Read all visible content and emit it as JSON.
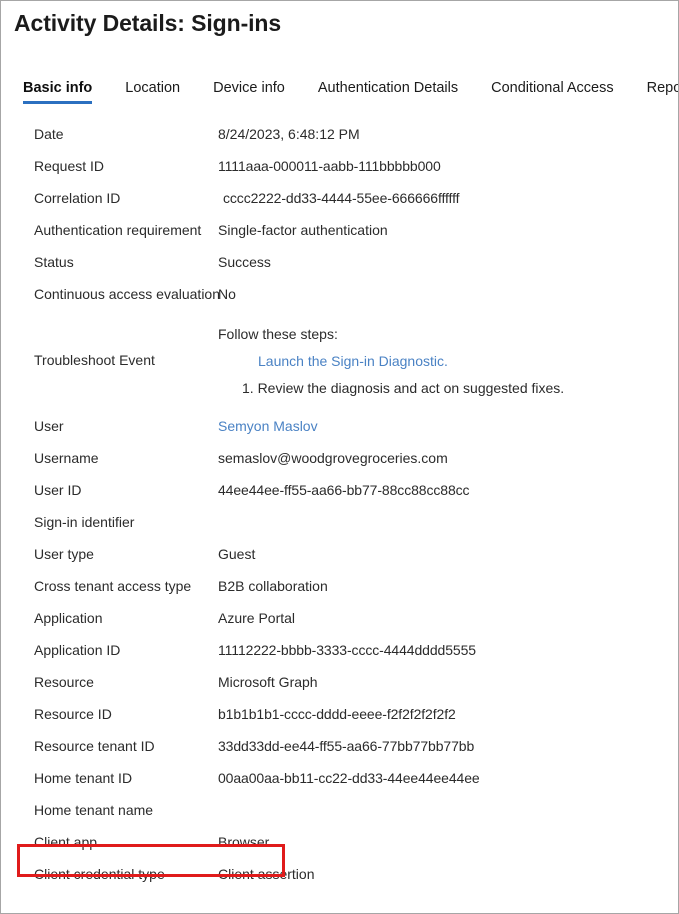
{
  "header": {
    "title": "Activity Details: Sign-ins"
  },
  "tabs": [
    {
      "label": "Basic info",
      "selected": true
    },
    {
      "label": "Location",
      "selected": false
    },
    {
      "label": "Device info",
      "selected": false
    },
    {
      "label": "Authentication Details",
      "selected": false
    },
    {
      "label": "Conditional Access",
      "selected": false
    },
    {
      "label": "Report-only",
      "selected": false
    }
  ],
  "rows": {
    "date": {
      "label": "Date",
      "value": "8/24/2023, 6:48:12 PM"
    },
    "request_id": {
      "label": "Request ID",
      "value": "1111aaa-000011-aabb-111bbbbb000"
    },
    "correlation_id": {
      "label": "Correlation ID",
      "value": "cccc2222-dd33-4444-55ee-666666ffffff"
    },
    "auth_requirement": {
      "label": "Authentication requirement",
      "value": "Single-factor authentication"
    },
    "status": {
      "label": "Status",
      "value": "Success"
    },
    "cae": {
      "label": "Continuous access evaluation",
      "value": "No"
    },
    "troubleshoot": {
      "label": "Troubleshoot Event",
      "intro": "Follow these steps:",
      "link": "Launch the Sign-in Diagnostic.",
      "step1": "1. Review the diagnosis and act on suggested fixes."
    },
    "user": {
      "label": "User",
      "value": "Semyon Maslov"
    },
    "username": {
      "label": "Username",
      "value": "semaslov@woodgrovegroceries.com"
    },
    "user_id": {
      "label": "User ID",
      "value": "44ee44ee-ff55-aa66-bb77-88cc88cc88cc"
    },
    "signin_identifier": {
      "label": "Sign-in identifier",
      "value": ""
    },
    "user_type": {
      "label": "User type",
      "value": "Guest"
    },
    "cross_tenant": {
      "label": "Cross tenant access type",
      "value": "B2B collaboration"
    },
    "application": {
      "label": "Application",
      "value": "Azure Portal"
    },
    "application_id": {
      "label": "Application ID",
      "value": "11112222-bbbb-3333-cccc-4444dddd5555"
    },
    "resource": {
      "label": "Resource",
      "value": "Microsoft Graph"
    },
    "resource_id": {
      "label": "Resource ID",
      "value": "b1b1b1b1-cccc-dddd-eeee-f2f2f2f2f2f2"
    },
    "resource_tenant_id": {
      "label": "Resource tenant ID",
      "value": "33dd33dd-ee44-ff55-aa66-77bb77bb77bb"
    },
    "home_tenant_id": {
      "label": "Home tenant ID",
      "value": "00aa00aa-bb11-cc22-dd33-44ee44ee44ee"
    },
    "home_tenant_name": {
      "label": "Home tenant name",
      "value": ""
    },
    "client_app": {
      "label": "Client app",
      "value": "Browser"
    },
    "client_credential_type": {
      "label": "Client credential type",
      "value": "Client assertion"
    }
  },
  "colors": {
    "accent": "#2b70c0",
    "link": "#4a82c4",
    "highlight": "#e01b1b",
    "text": "#2b2b2b",
    "border": "#a6a6a6"
  },
  "annotation": {
    "highlight_target": "Client app"
  }
}
